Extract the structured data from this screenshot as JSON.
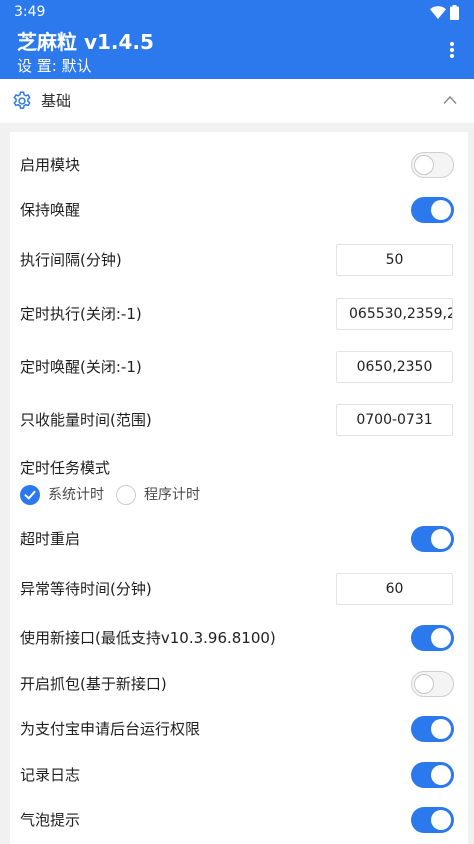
{
  "status_bar": {
    "time": "3:49",
    "wifi_icon": "wifi-icon",
    "battery_icon": "battery-icon"
  },
  "app_bar": {
    "title": "芝麻粒 v1.4.5",
    "subtitle": "设 置: 默认",
    "menu_icon": "more-vertical-icon"
  },
  "section": {
    "title": "基础",
    "icon": "gear-icon",
    "collapse_icon": "chevron-up-icon",
    "expanded": true
  },
  "settings": {
    "enable_module": {
      "label": "启用模块",
      "on": false
    },
    "keep_awake": {
      "label": "保持唤醒",
      "on": true
    },
    "exec_interval": {
      "label": "执行间隔(分钟)",
      "value": "50"
    },
    "timed_exec": {
      "label": "定时执行(关闭:-1)",
      "value": "065530,2359,2"
    },
    "timed_wake": {
      "label": "定时唤醒(关闭:-1)",
      "value": "0650,2350"
    },
    "energy_time": {
      "label": "只收能量时间(范围)",
      "value": "0700-0731"
    },
    "task_mode": {
      "label": "定时任务模式",
      "options": [
        "系统计时",
        "程序计时"
      ],
      "selected": "系统计时"
    },
    "timeout_restart": {
      "label": "超时重启",
      "on": true
    },
    "abnormal_wait": {
      "label": "异常等待时间(分钟)",
      "value": "60"
    },
    "new_api": {
      "label": "使用新接口(最低支持v10.3.96.8100)",
      "on": true
    },
    "capture": {
      "label": "开启抓包(基于新接口)",
      "on": false
    },
    "background_permission": {
      "label": "为支付宝申请后台运行权限",
      "on": true
    },
    "log": {
      "label": "记录日志",
      "on": true
    },
    "bubble_tip": {
      "label": "气泡提示",
      "on": true
    }
  },
  "colors": {
    "primary": "#2b79ed",
    "background": "#f1f1f1",
    "card": "#ffffff",
    "switch_off_track": "#f4f4f4"
  }
}
